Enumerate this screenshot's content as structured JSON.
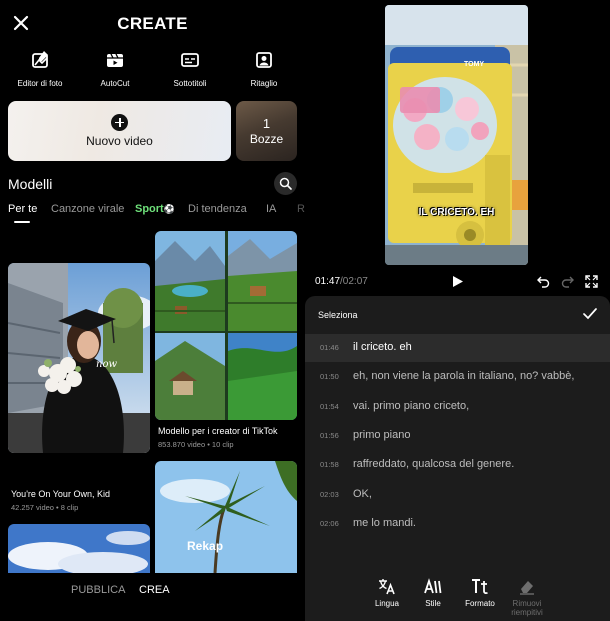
{
  "left": {
    "title": "CREATE",
    "tools": [
      {
        "label": "Editor di foto",
        "icon": "photo-edit-icon"
      },
      {
        "label": "AutoCut",
        "icon": "autocut-icon"
      },
      {
        "label": "Sottotitoli",
        "icon": "subtitles-icon"
      },
      {
        "label": "Ritaglio",
        "icon": "cutout-icon"
      }
    ],
    "new_video_label": "Nuovo video",
    "drafts": {
      "count": "1",
      "label": "Bozze"
    },
    "section_title": "Modelli",
    "tabs": [
      "Per te",
      "Canzone virale",
      "Sport",
      "Di tendenza",
      "IA",
      "R"
    ],
    "templates": [
      {
        "title": "You're On Your Own, Kid",
        "meta": "42.257 video • 8 clip",
        "overlay": "now"
      },
      {
        "title": "Modello per i creator di TikTok",
        "meta": "853.870 video • 10 clip"
      },
      {
        "overlay": "Rekap"
      }
    ],
    "bottom_nav": [
      "PUBBLICA",
      "CREA"
    ]
  },
  "right": {
    "caption_overlay": "IL CRICETO. EH",
    "brand_label": "TOMY",
    "time_current": "01:47",
    "time_total": "/02:07",
    "sheet_title": "Seleziona",
    "subtitles": [
      {
        "time": "01:46",
        "text": "il criceto. eh"
      },
      {
        "time": "01:50",
        "text": "eh, non viene la parola in italiano, no? vabbè,"
      },
      {
        "time": "01:54",
        "text": "vai. primo piano criceto,"
      },
      {
        "time": "01:56",
        "text": "primo piano"
      },
      {
        "time": "01:58",
        "text": "raffreddato, qualcosa del genere."
      },
      {
        "time": "02:03",
        "text": "OK,"
      },
      {
        "time": "02:06",
        "text": "me lo mandi."
      }
    ],
    "tools": [
      {
        "label": "Lingua",
        "icon": "translate-icon"
      },
      {
        "label": "Stile",
        "icon": "style-icon"
      },
      {
        "label": "Formato",
        "icon": "format-icon"
      },
      {
        "label": "Rimuovi riempitivi",
        "icon": "eraser-icon"
      }
    ]
  },
  "colors": {
    "sport_tab": "#6ee07a",
    "sheet_bg": "#1c1c1c",
    "active_row": "#2c2c2c"
  }
}
